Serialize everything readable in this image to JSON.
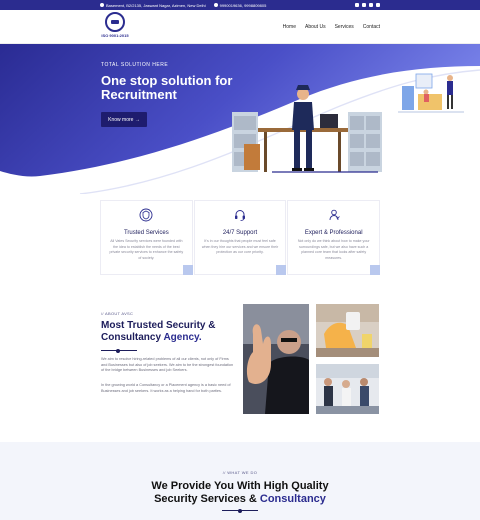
{
  "topbar": {
    "address": "Basement, B2/2135, Jaswant Nagar, Azimen, New Delhi",
    "phone": "9990019636, 9998809805"
  },
  "header": {
    "logo_text": "ISO 9001:2015",
    "nav": [
      "Home",
      "About Us",
      "Services",
      "Contact"
    ]
  },
  "hero": {
    "eyebrow": "TOTAL SOLUTION HERE",
    "title": "One stop solution for Recruitment",
    "button": "Know more  →"
  },
  "features": [
    {
      "title": "Trusted Services",
      "icon": "shield-network-icon",
      "desc": "All Vates Security services were founded with the idea to establish the needs of the best private security services to enhance the safety of society."
    },
    {
      "title": "24/7 Support",
      "icon": "headset-icon",
      "desc": "It's in our thoughts that people must feel safe when they hire our services and we ensure their protection as our core priority."
    },
    {
      "title": "Expert & Professional",
      "icon": "expert-badge-icon",
      "desc": "Not only do we think about how to make your surroundings safe, but we also have such a planned core team that looks after safety measures."
    }
  ],
  "about": {
    "eyebrow": "// ABOUT AVSC",
    "title_main": "Most Trusted Security & Consultancy",
    "title_accent": "Agency.",
    "p1": "We aim to resolve hiring-related problems of all our clients, not only of Firms and Businesses but also of job seekers. We aim to be the strongest foundation of the bridge between Businesses and job Seekers.",
    "p2": "In the growing world a Consultancy or a Placement agency is a basic need of Businesses and job seekers. It works as a helping hand for both parties."
  },
  "services": {
    "eyebrow": "// WHAT WE DO",
    "title_main": "We Provide You With High Quality Security Services &",
    "title_accent": "Consultancy"
  },
  "colors": {
    "brand": "#2b2c8f",
    "hero_gradient_start": "#2a2b93",
    "hero_gradient_end": "#6a73e0",
    "card_corner": "#b9c8ee"
  }
}
